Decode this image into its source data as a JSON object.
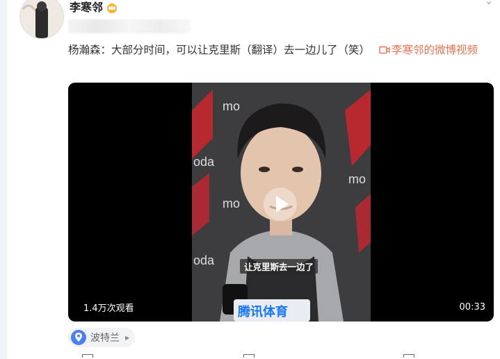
{
  "post": {
    "author_name": "李寒邻",
    "text": "杨瀚森：大部分时间，可以让克里斯（翻译）去一边儿了（笑）",
    "video_link_label": "李寒邻的微博视频"
  },
  "video": {
    "subtitle": "让克里斯去一边了",
    "views": "1.4万次观看",
    "duration": "00:33"
  },
  "location": {
    "name": "波特兰"
  },
  "colors": {
    "link": "#eb7350",
    "location_pin": "#4a7ff7"
  }
}
